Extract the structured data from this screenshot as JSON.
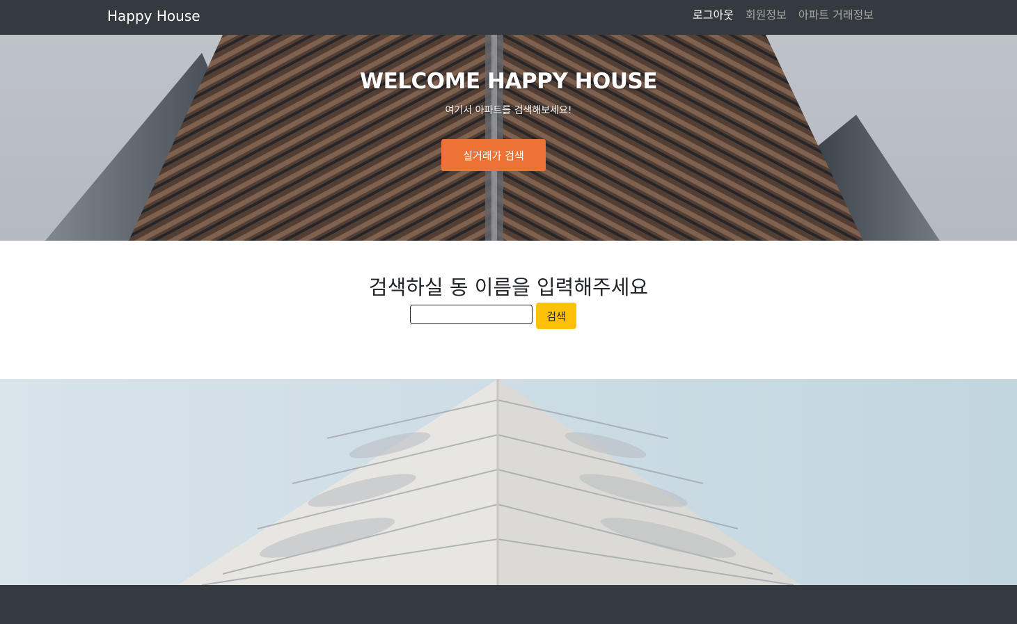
{
  "navbar": {
    "brand": "Happy House",
    "links": [
      {
        "label": "로그아웃",
        "active": true
      },
      {
        "label": "회원정보",
        "active": false
      },
      {
        "label": "아파트 거래정보",
        "active": false
      }
    ]
  },
  "hero": {
    "title": "WELCOME HAPPY HOUSE",
    "subtitle": "여기서 아파트를 검색해보세요!",
    "button_label": "실거래가 검색"
  },
  "search": {
    "heading": "검색하실 동 이름을 입력해주세요",
    "input_value": "",
    "button_label": "검색"
  },
  "colors": {
    "navbar": "#343a40",
    "hero_button": "#ed7235",
    "search_button": "#ffc107"
  }
}
